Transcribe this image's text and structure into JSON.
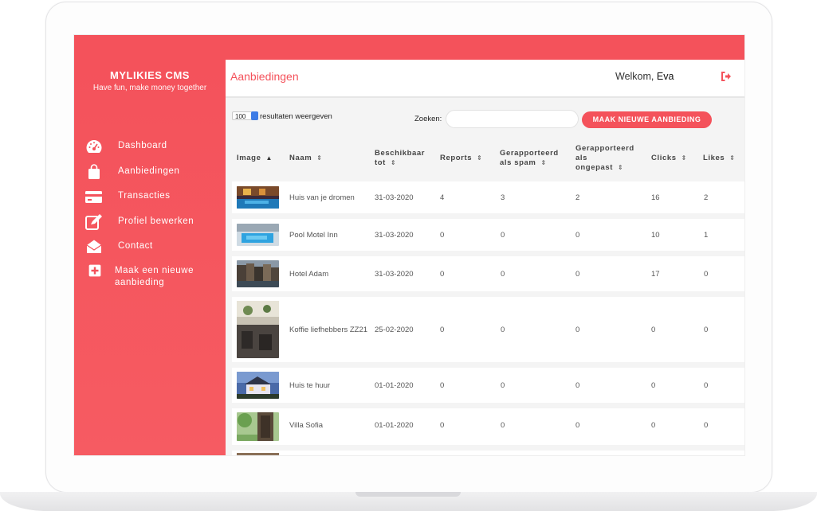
{
  "app": {
    "brand_title": "MYLIKIES CMS",
    "brand_subtitle": "Have fun, make money together"
  },
  "sidebar": {
    "items": [
      {
        "label": "Dashboard",
        "icon": "dashboard-gauge-icon"
      },
      {
        "label": "Aanbiedingen",
        "icon": "shopping-bag-icon"
      },
      {
        "label": "Transacties",
        "icon": "credit-card-icon"
      },
      {
        "label": "Profiel bewerken",
        "icon": "edit-icon"
      },
      {
        "label": "Contact",
        "icon": "envelope-open-icon"
      },
      {
        "label": "Maak een nieuwe aanbieding",
        "icon": "plus-square-icon"
      }
    ]
  },
  "header": {
    "title": "Aanbiedingen",
    "welcome_prefix": "Welkom,",
    "user_name": "Eva",
    "logout_icon": "sign-out-icon"
  },
  "controls": {
    "page_length": "100",
    "page_length_label": "resultaten weergeven",
    "search_label": "Zoeken:",
    "search_value": "",
    "new_button": "MAAK NIEUWE AANBIEDING"
  },
  "table": {
    "columns": [
      {
        "line1": "Image",
        "line2": "",
        "line3": "",
        "sort": "asc"
      },
      {
        "line1": "Naam",
        "line2": "",
        "line3": "",
        "sort": "both"
      },
      {
        "line1": "Beschikbaar",
        "line2": "tot",
        "line3": "",
        "sort": "both"
      },
      {
        "line1": "Reports",
        "line2": "",
        "line3": "",
        "sort": "both"
      },
      {
        "line1": "Gerapporteerd",
        "line2": "als spam",
        "line3": "",
        "sort": "both"
      },
      {
        "line1": "Gerapporteerd",
        "line2": "als",
        "line3": "ongepast",
        "sort": "both"
      },
      {
        "line1": "Clicks",
        "line2": "",
        "line3": "",
        "sort": "both"
      },
      {
        "line1": "Likes",
        "line2": "",
        "line3": "",
        "sort": "both"
      }
    ],
    "rows": [
      {
        "name": "Huis van je dromen",
        "date": "31-03-2020",
        "reports": "4",
        "spam": "3",
        "improper": "2",
        "clicks": "16",
        "likes": "2",
        "image": "hotel-night-pool-photo"
      },
      {
        "name": "Pool Motel Inn",
        "date": "31-03-2020",
        "reports": "0",
        "spam": "0",
        "improper": "0",
        "clicks": "10",
        "likes": "1",
        "image": "indoor-pool-photo"
      },
      {
        "name": "Hotel Adam",
        "date": "31-03-2020",
        "reports": "0",
        "spam": "0",
        "improper": "0",
        "clicks": "17",
        "likes": "0",
        "image": "canal-houses-photo"
      },
      {
        "name": "Koffie liefhebbers ZZ21",
        "date": "25-02-2020",
        "reports": "0",
        "spam": "0",
        "improper": "0",
        "clicks": "0",
        "likes": "0",
        "image": "coffee-bar-interior-photo"
      },
      {
        "name": "Huis te huur",
        "date": "01-01-2020",
        "reports": "0",
        "spam": "0",
        "improper": "0",
        "clicks": "0",
        "likes": "0",
        "image": "house-dusk-photo"
      },
      {
        "name": "Villa Sofia",
        "date": "01-01-2020",
        "reports": "0",
        "spam": "0",
        "improper": "0",
        "clicks": "0",
        "likes": "0",
        "image": "garden-door-photo"
      }
    ]
  },
  "colors": {
    "accent": "#f4525b",
    "background": "#f4f4f4",
    "sort_indicator": "#3d7ce6"
  }
}
